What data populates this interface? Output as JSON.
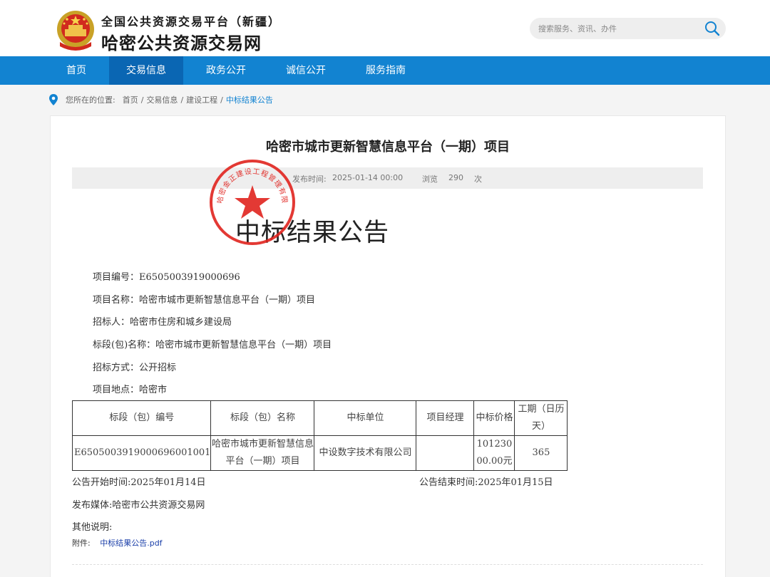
{
  "header": {
    "subtitle": "全国公共资源交易平台（新疆）",
    "title": "哈密公共资源交易网",
    "search_placeholder": "搜索服务、资讯、办件"
  },
  "nav": {
    "items": [
      "首页",
      "交易信息",
      "政务公开",
      "诚信公开",
      "服务指南"
    ],
    "active": "交易信息"
  },
  "breadcrumb": {
    "prefix": "您所在的位置:",
    "items": [
      "首页",
      "交易信息",
      "建设工程",
      "中标结果公告"
    ],
    "separator": "/"
  },
  "article": {
    "title": "哈密市城市更新智慧信息平台（一期）项目",
    "publish_label": "发布时间:",
    "publish_time": "2025-01-14 00:00",
    "views_label": "浏览",
    "views": "290",
    "views_unit": "次",
    "stamp": {
      "top_text": "哈密金正建设工程管理有限公司",
      "color": "#e0231e"
    },
    "notice_title": "中标结果公告",
    "fields": [
      "项目编号：E6505003919000696",
      "项目名称：哈密市城市更新智慧信息平台（一期）项目",
      "招标人：哈密市住房和城乡建设局",
      "标段(包)名称：哈密市城市更新智慧信息平台（一期）项目",
      "招标方式：公开招标",
      "项目地点：哈密市"
    ],
    "table": {
      "headers": [
        "标段（包）编号",
        "标段（包）名称",
        "中标单位",
        "项目经理",
        "中标价格",
        "工期（日历天）"
      ],
      "rows": [
        [
          "E6505003919000696001001",
          "哈密市城市更新智慧信息平台（一期）项目",
          "中设数字技术有限公司",
          "",
          "10123000.00元",
          "365"
        ]
      ]
    },
    "start_time": "公告开始时间:2025年01月14日",
    "end_time": "公告结束时间:2025年01月15日",
    "media": "发布媒体:哈密市公共资源交易网",
    "remarks": "其他说明:",
    "attachment_label": "附件:",
    "attachment_name": "中标结果公告.pdf"
  },
  "colors": {
    "nav": "#1283d1",
    "nav_active": "#0a66b3",
    "link": "#1283d1"
  }
}
